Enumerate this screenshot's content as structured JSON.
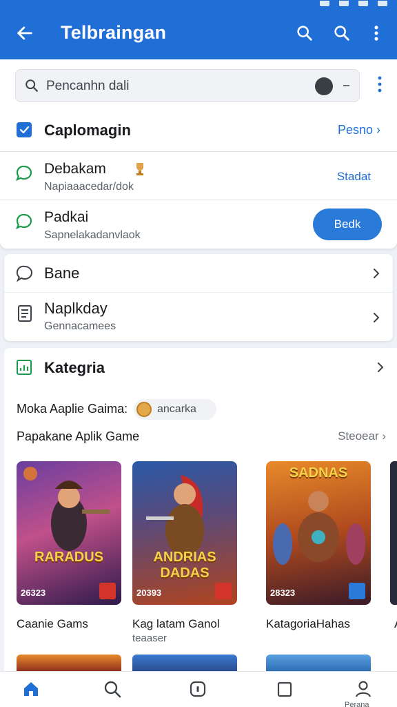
{
  "app_bar": {
    "title": "Telbraingan",
    "bg_color": "#1f6fd6"
  },
  "search": {
    "placeholder": "Pencanhn dali"
  },
  "header_row": {
    "label": "Caplomagin",
    "link": "Pesno"
  },
  "chat_rows": [
    {
      "title": "Debakam",
      "subtitle": "Napiaaacedar/dok",
      "action": "Stadat"
    },
    {
      "title": "Padkai",
      "subtitle": "Sapnelakadanvlaok",
      "action": "Bedk"
    }
  ],
  "menu": [
    {
      "label": "Bane"
    },
    {
      "label": "Naplkday",
      "sub": "Gennacamees"
    }
  ],
  "category": {
    "label": "Kategria",
    "promo": "Moka Aaplie Gaima:",
    "chip": "ancarka",
    "subtitle": "Papakane Aplik Game",
    "see_all": "Steoear"
  },
  "games": [
    {
      "title": "Caanie Gams",
      "logo": "RARADUS",
      "year": "26323"
    },
    {
      "title": "Kag latam Ganol",
      "subtitle": "teaaser",
      "logo": "ANDRIAS DADAS",
      "year": "20393"
    },
    {
      "title": "KatagoriaHahas",
      "logo": "SADNAS",
      "year": "28323"
    }
  ],
  "peek_letter": "A",
  "nav": {
    "profile_label": "Perana"
  }
}
